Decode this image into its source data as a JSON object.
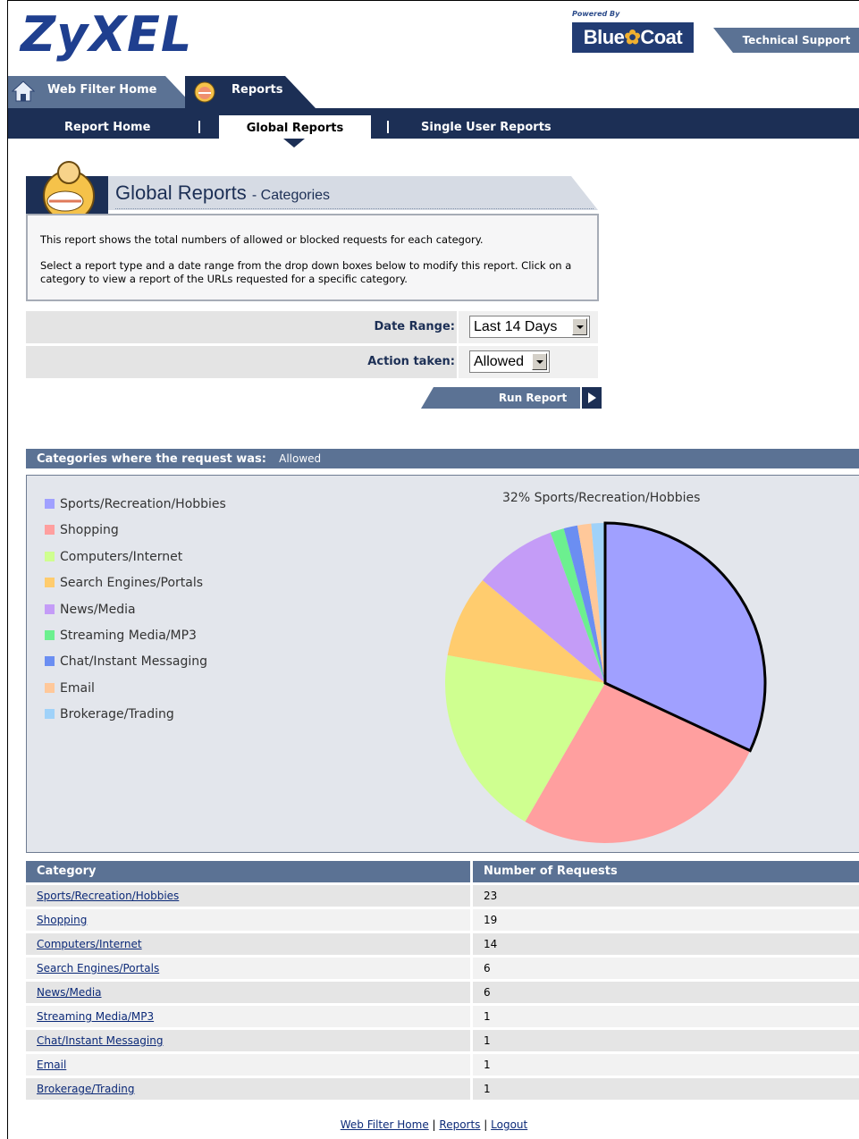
{
  "header": {
    "logo": "ZyXEL",
    "powered_by": "Powered By",
    "bluecoat_logo": "Blue Coat",
    "bluecoat_left": "Blue",
    "bluecoat_right": "Coat",
    "tech_support": "Technical Support"
  },
  "tabs": [
    {
      "label": "Web Filter Home",
      "icon": "house-icon"
    },
    {
      "label": "Reports",
      "icon": "reports-icon"
    }
  ],
  "subnav": {
    "items": [
      "Report Home",
      "Global Reports",
      "Single User Reports"
    ],
    "active": "Global Reports"
  },
  "section": {
    "title": "Global Reports",
    "subtitle": "- Categories",
    "desc1": "This report shows the total numbers of allowed or blocked requests for each category.",
    "desc2": "Select a report type and a date range from the drop down boxes below to modify this report. Click on a category to view a report of the URLs requested for a specific category."
  },
  "form": {
    "date_range_label": "Date Range:",
    "date_range_value": "Last 14 Days",
    "action_label": "Action taken:",
    "action_value": "Allowed",
    "run_button": "Run Report"
  },
  "results": {
    "header_label": "Categories where the request was:",
    "header_value": "Allowed",
    "pie_label": "32%  Sports/Recreation/Hobbies"
  },
  "chart_data": {
    "type": "pie",
    "categories": [
      "Sports/Recreation/Hobbies",
      "Shopping",
      "Computers/Internet",
      "Search Engines/Portals",
      "News/Media",
      "Streaming Media/MP3",
      "Chat/Instant Messaging",
      "Email",
      "Brokerage/Trading"
    ],
    "values": [
      23,
      19,
      14,
      6,
      6,
      1,
      1,
      1,
      1
    ],
    "colors": [
      "#a0a0ff",
      "#ff9f9f",
      "#cfff90",
      "#ffcc6e",
      "#c49cf7",
      "#6cf08f",
      "#6b8ef2",
      "#ffc89a",
      "#a0d2f9"
    ],
    "highlighted": "Sports/Recreation/Hobbies"
  },
  "table": {
    "headers": [
      "Category",
      "Number of Requests"
    ],
    "rows": [
      {
        "category": "Sports/Recreation/Hobbies",
        "count": "23"
      },
      {
        "category": "Shopping",
        "count": "19"
      },
      {
        "category": "Computers/Internet",
        "count": "14"
      },
      {
        "category": "Search Engines/Portals",
        "count": "6"
      },
      {
        "category": "News/Media",
        "count": "6"
      },
      {
        "category": "Streaming Media/MP3",
        "count": "1"
      },
      {
        "category": "Chat/Instant Messaging",
        "count": "1"
      },
      {
        "category": "Email",
        "count": "1"
      },
      {
        "category": "Brokerage/Trading",
        "count": "1"
      }
    ]
  },
  "footer": {
    "links": [
      "Web Filter Home",
      "Reports",
      "Logout"
    ],
    "separator": "|"
  }
}
